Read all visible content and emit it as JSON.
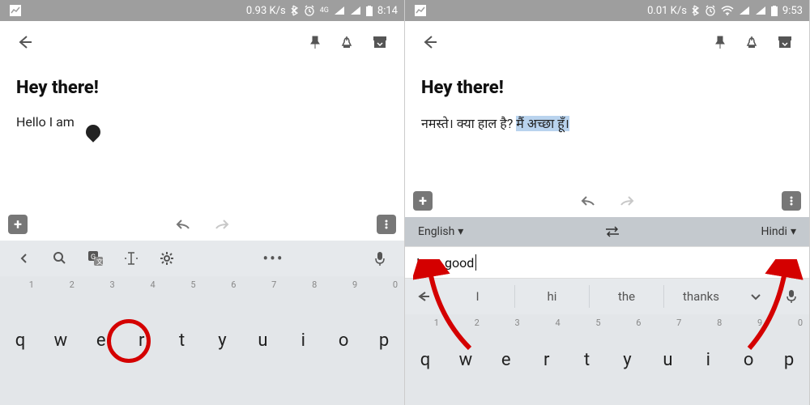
{
  "left": {
    "status": {
      "speed": "0.93 K/s",
      "net": "4G",
      "time": "8:14"
    },
    "title": "Hey there!",
    "body": "Hello I am",
    "keys": [
      {
        "k": "q",
        "n": "1"
      },
      {
        "k": "w",
        "n": "2"
      },
      {
        "k": "e",
        "n": "3"
      },
      {
        "k": "r",
        "n": "4"
      },
      {
        "k": "t",
        "n": "5"
      },
      {
        "k": "y",
        "n": "6"
      },
      {
        "k": "u",
        "n": "7"
      },
      {
        "k": "i",
        "n": "8"
      },
      {
        "k": "o",
        "n": "9"
      },
      {
        "k": "p",
        "n": "0"
      }
    ]
  },
  "right": {
    "status": {
      "speed": "0.01 K/s",
      "time": "9:53"
    },
    "title": "Hey there!",
    "body_plain": "नमस्ते। क्या हाल है? ",
    "body_hl": "मैं अच्छा हूँ।",
    "lang_from": "English",
    "lang_to": "Hindi",
    "input": "I am good",
    "suggestions": [
      "I",
      "hi",
      "the",
      "thanks"
    ],
    "keys": [
      {
        "k": "q",
        "n": "1"
      },
      {
        "k": "w",
        "n": "2"
      },
      {
        "k": "e",
        "n": "3"
      },
      {
        "k": "r",
        "n": "4"
      },
      {
        "k": "t",
        "n": "5"
      },
      {
        "k": "y",
        "n": "6"
      },
      {
        "k": "u",
        "n": "7"
      },
      {
        "k": "i",
        "n": "8"
      },
      {
        "k": "o",
        "n": "9"
      },
      {
        "k": "p",
        "n": "0"
      }
    ]
  }
}
